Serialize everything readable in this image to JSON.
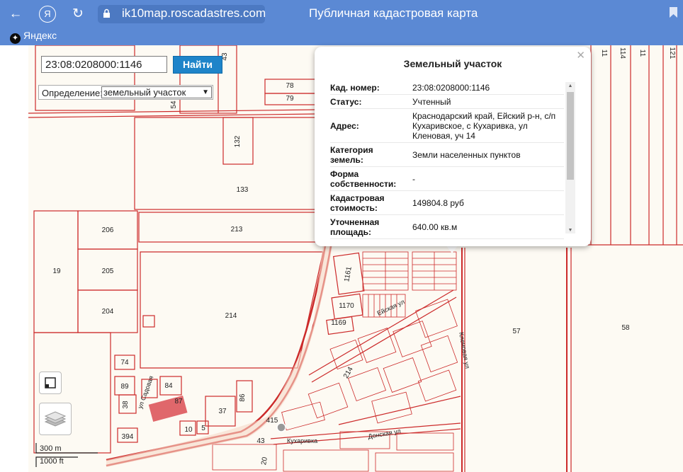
{
  "browser": {
    "url": "ik10map.roscadastres.com",
    "page_title": "Публичная кадастровая карта",
    "bookmark": "Яндекс"
  },
  "search": {
    "value": "23:08:0208000:1146",
    "button_label": "Найти"
  },
  "definition": {
    "label": "Определение:",
    "selected": "земельный участок"
  },
  "popup": {
    "title": "Земельный участок",
    "rows": [
      {
        "key": "Кад. номер:",
        "value": "23:08:0208000:1146"
      },
      {
        "key": "Статус:",
        "value": "Учтенный"
      },
      {
        "key": "Адрес:",
        "value": "Краснодарский край, Ейский р-н, с/п Кухаривское, с Кухаривка, ул Кленовая, уч 14"
      },
      {
        "key": "Категория земель:",
        "value": "Земли населенных пунктов"
      },
      {
        "key": "Форма собственности:",
        "value": "-"
      },
      {
        "key": "Кадастровая стоимость:",
        "value": "149804.8 руб"
      },
      {
        "key": "Уточненная площадь:",
        "value": "640.00 кв.м"
      }
    ]
  },
  "scale": {
    "metric": "300 m",
    "imperial": "1000 ft"
  },
  "map": {
    "streets": [
      "Ейская ул",
      "Кленовая ул",
      "ул Садовая",
      "Кухаривка",
      "Донская ул"
    ],
    "parcels": [
      "43",
      "78",
      "79",
      "54",
      "132",
      "133",
      "206",
      "213",
      "205",
      "19",
      "204",
      "214",
      "74",
      "89",
      "84",
      "87",
      "38",
      "37",
      "86",
      "394",
      "10",
      "5",
      "415",
      "43",
      "20",
      "1161",
      "1170",
      "1169",
      "214",
      "57",
      "58",
      "11",
      "114",
      "11",
      "121"
    ]
  },
  "colors": {
    "parcel_line": "#cc2a2a",
    "chrome": "#5b89d4",
    "button": "#1e84c9"
  }
}
